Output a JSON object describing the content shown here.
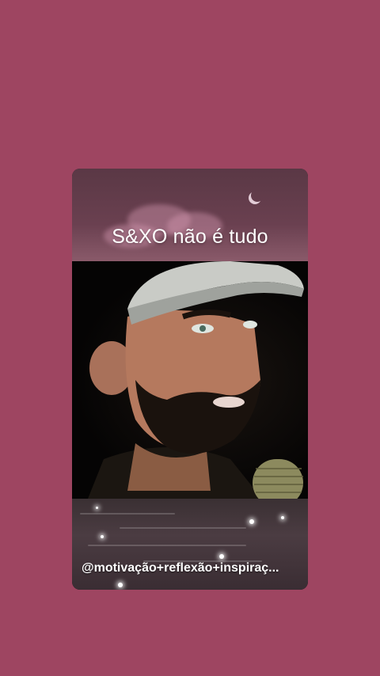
{
  "story": {
    "title": "S&XO não é tudo",
    "caption": "@motivação+reflexão+inspiraç..."
  },
  "colors": {
    "background": "#9e4561",
    "text": "#ffffff"
  },
  "icons": {
    "moon": "crescent-moon-icon"
  }
}
